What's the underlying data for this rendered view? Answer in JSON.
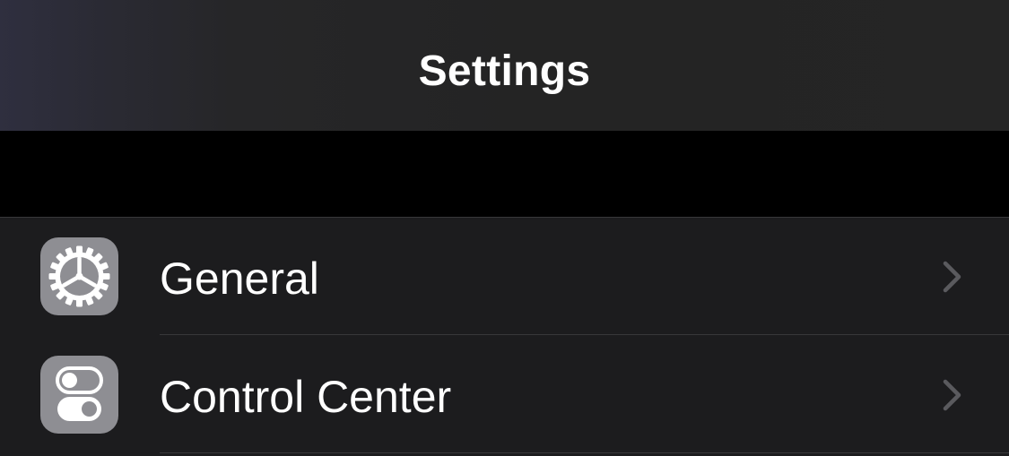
{
  "nav": {
    "title": "Settings"
  },
  "settings_list": {
    "items": [
      {
        "label": "General",
        "icon": "gear-icon",
        "icon_bg": "#8e8e93"
      },
      {
        "label": "Control Center",
        "icon": "control-center-icon",
        "icon_bg": "#8e8e93"
      }
    ]
  },
  "colors": {
    "background": "#000000",
    "cell_background": "#1c1c1e",
    "separator": "#38383a",
    "chevron": "#5a5a5e",
    "text": "#ffffff"
  }
}
